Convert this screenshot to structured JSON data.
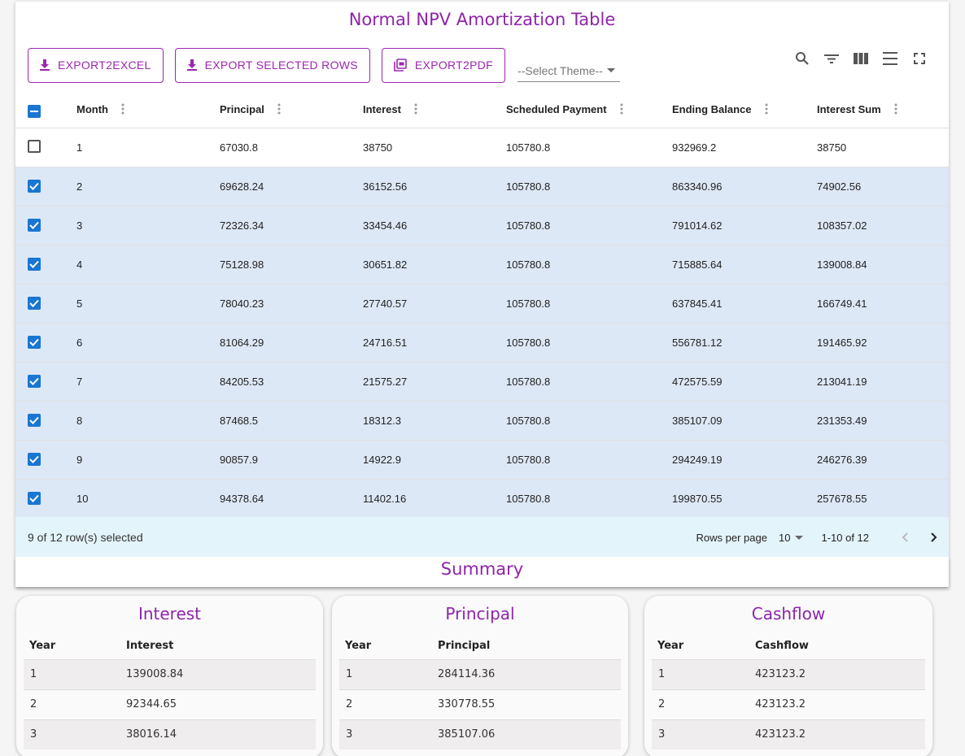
{
  "main": {
    "title": "Normal NPV Amortization Table",
    "buttons": {
      "export_excel": "EXPORT2EXCEL",
      "export_selected": "EXPORT SELECTED ROWS",
      "export_pdf": "EXPORT2PDF"
    },
    "theme_select": {
      "value": "--Select Theme--"
    },
    "columns": [
      "Month",
      "Principal",
      "Interest",
      "Scheduled Payment",
      "Ending Balance",
      "Interest Sum"
    ],
    "rows": [
      {
        "selected": false,
        "cells": [
          "1",
          "67030.8",
          "38750",
          "105780.8",
          "932969.2",
          "38750"
        ]
      },
      {
        "selected": true,
        "cells": [
          "2",
          "69628.24",
          "36152.56",
          "105780.8",
          "863340.96",
          "74902.56"
        ]
      },
      {
        "selected": true,
        "cells": [
          "3",
          "72326.34",
          "33454.46",
          "105780.8",
          "791014.62",
          "108357.02"
        ]
      },
      {
        "selected": true,
        "cells": [
          "4",
          "75128.98",
          "30651.82",
          "105780.8",
          "715885.64",
          "139008.84"
        ]
      },
      {
        "selected": true,
        "cells": [
          "5",
          "78040.23",
          "27740.57",
          "105780.8",
          "637845.41",
          "166749.41"
        ]
      },
      {
        "selected": true,
        "cells": [
          "6",
          "81064.29",
          "24716.51",
          "105780.8",
          "556781.12",
          "191465.92"
        ]
      },
      {
        "selected": true,
        "cells": [
          "7",
          "84205.53",
          "21575.27",
          "105780.8",
          "472575.59",
          "213041.19"
        ]
      },
      {
        "selected": true,
        "cells": [
          "8",
          "87468.5",
          "18312.3",
          "105780.8",
          "385107.09",
          "231353.49"
        ]
      },
      {
        "selected": true,
        "cells": [
          "9",
          "90857.9",
          "14922.9",
          "105780.8",
          "294249.19",
          "246276.39"
        ]
      },
      {
        "selected": true,
        "cells": [
          "10",
          "94378.64",
          "11402.16",
          "105780.8",
          "199870.55",
          "257678.55"
        ]
      }
    ],
    "footer": {
      "selected_text": "9 of 12 row(s) selected",
      "rows_per_page_label": "Rows per page",
      "rows_per_page_value": "10",
      "range": "1-10 of 12"
    }
  },
  "summary": {
    "title": "Summary",
    "cards": [
      {
        "title": "Interest",
        "headers": [
          "Year",
          "Interest"
        ],
        "rows": [
          [
            "1",
            "139008.84"
          ],
          [
            "2",
            "92344.65"
          ],
          [
            "3",
            "38016.14"
          ]
        ]
      },
      {
        "title": "Principal",
        "headers": [
          "Year",
          "Principal"
        ],
        "rows": [
          [
            "1",
            "284114.36"
          ],
          [
            "2",
            "330778.55"
          ],
          [
            "3",
            "385107.06"
          ]
        ]
      },
      {
        "title": "Cashflow",
        "headers": [
          "Year",
          "Cashflow"
        ],
        "rows": [
          [
            "1",
            "423123.2"
          ],
          [
            "2",
            "423123.2"
          ],
          [
            "3",
            "423123.2"
          ]
        ]
      }
    ]
  },
  "colors": {
    "accent": "#9c27b0",
    "title": "#8e24aa",
    "checkbox": "#1976d2",
    "selected_row": "#dde8f6",
    "footer_bg": "#e4f4fb"
  },
  "icons": [
    "download-icon",
    "pdf-icon",
    "search-icon",
    "filter-icon",
    "columns-icon",
    "density-icon",
    "fullscreen-icon",
    "chevron-left-icon",
    "chevron-right-icon",
    "column-menu-icon"
  ]
}
